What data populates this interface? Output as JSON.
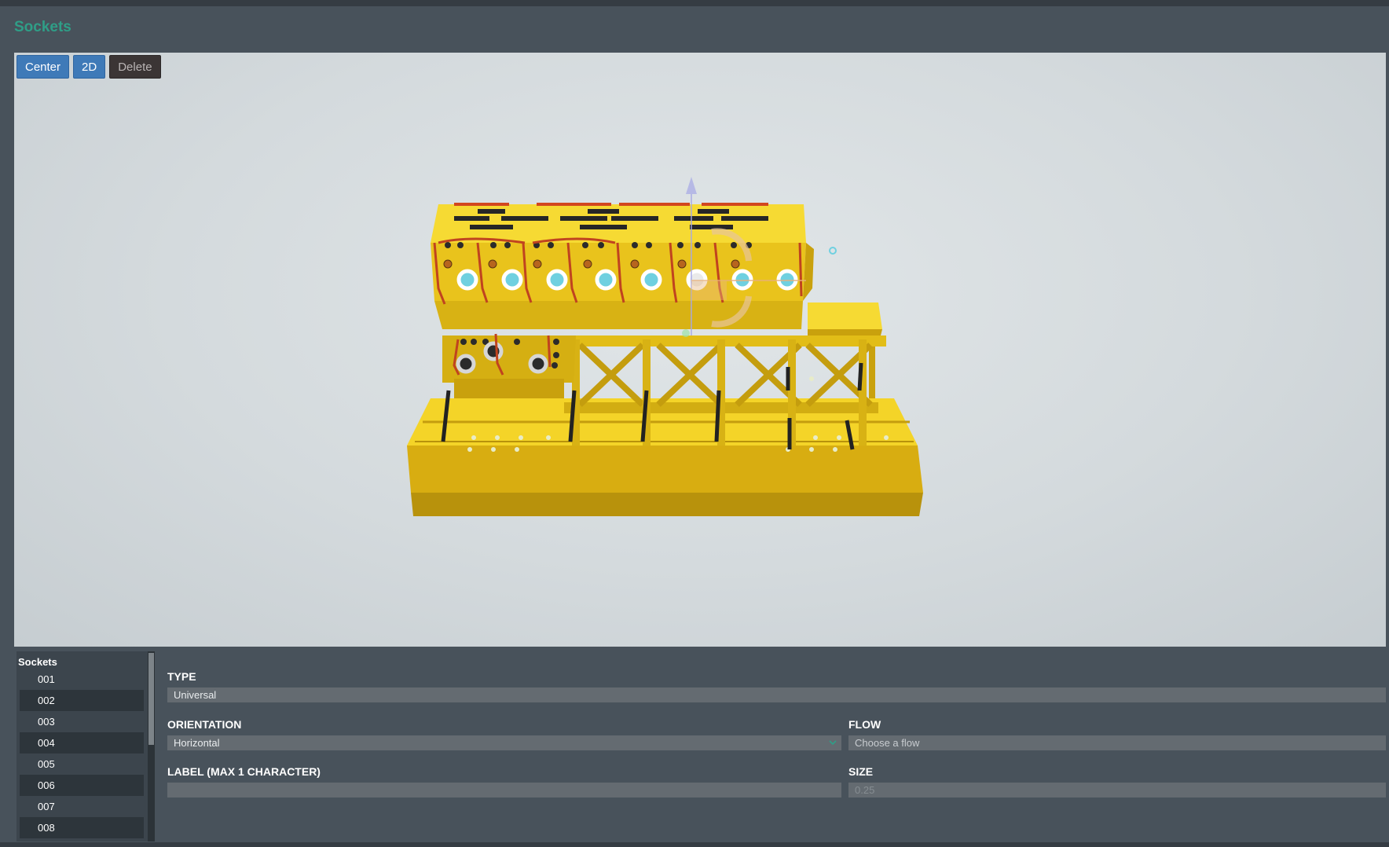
{
  "page": {
    "title": "Sockets"
  },
  "toolbar": {
    "center_label": "Center",
    "two_d_label": "2D",
    "delete_label": "Delete"
  },
  "sockets": {
    "heading": "Sockets",
    "items": [
      "001",
      "002",
      "003",
      "004",
      "005",
      "006",
      "007",
      "008"
    ]
  },
  "form": {
    "type": {
      "label": "TYPE",
      "value": "Universal"
    },
    "orientation": {
      "label": "ORIENTATION",
      "value": "Horizontal"
    },
    "flow": {
      "label": "FLOW",
      "placeholder": "Choose a flow"
    },
    "socket_label": {
      "label": "LABEL (MAX 1 CHARACTER)",
      "value": ""
    },
    "size": {
      "label": "SIZE",
      "placeholder": "0.25"
    }
  },
  "colors": {
    "accent_title": "#2f9e87",
    "button_blue": "#3f7ab8",
    "button_dark": "#3b3535",
    "model_yellow": "#f2cf1f",
    "socket_cyan": "#6fd0e0",
    "pipe_red": "#c0431f"
  },
  "icons": {
    "dropdown": "chevron-down-icon",
    "gizmo": "transform-gizmo"
  }
}
